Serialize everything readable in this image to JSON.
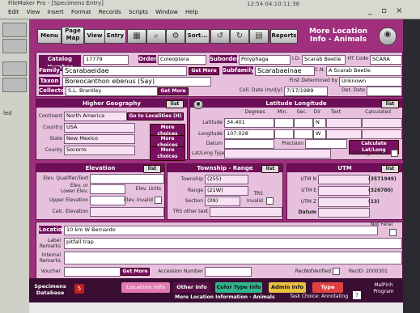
{
  "os": {
    "title": "FileMaker Pro - [Specimens Entry]",
    "menus": [
      "Edit",
      "View",
      "Insert",
      "Format",
      "Records",
      "Scripts",
      "Window",
      "Help"
    ],
    "clock": "12:54 04:10:11:38",
    "window_controls": "_ ▫ ×"
  },
  "left_panel": {
    "label": "led"
  },
  "toolbar": {
    "menu": "Menu",
    "page_map": "Page\nMap",
    "view": "View",
    "entry": "Entry",
    "sort": "Sort...",
    "reports": "Reports",
    "page_title": "More Location Info - Animals"
  },
  "catalog": {
    "catalog_number_label": "Catalog Number",
    "catalog_number": "17779",
    "order_label": "Order",
    "order": "Coleoptera",
    "suborder_label": "Suborder",
    "suborder": "Polyphaga",
    "id_label": "I.D.",
    "id": "Scarab Beetle",
    "ht_code_label": "HT Code",
    "ht_code": "SCARA",
    "family_label": "Family",
    "family": "Scarabaeidae",
    "get_more_1": "Get More",
    "subfamily_label": "Subfamily",
    "subfamily": "Scarabaeinae",
    "cn_label": "C.N.",
    "cn": "A Scarab Beetle",
    "taxon_label": "Taxon",
    "taxon": "Boreocanthon ebenus (Say)",
    "first_det_label": "First Determined by",
    "first_det": "Unknown",
    "collector_label": "Collector",
    "collector": "S.L. Brantley",
    "get_more_2": "Get More",
    "coll_date_label": "Coll. Date (m/d/y)",
    "coll_date": "7/17/1989",
    "det_date_label": "Det. Date",
    "det_date": ""
  },
  "higher_geo": {
    "title": "Higher Geography",
    "list": "list",
    "continent_label": "Continent",
    "continent": "North America",
    "go_to_localities": "Go to Localities (H)",
    "country_label": "Country",
    "country": "USA",
    "state_label": "State",
    "state": "New Mexico",
    "county_label": "County",
    "county": "Socorro",
    "more_choices": "More choices"
  },
  "latlong": {
    "title": "Latitude Longitude",
    "list": "list",
    "col_degrees": "Degrees",
    "col_min": "Min.",
    "col_sec": "Sec.",
    "col_dir": "Dir",
    "col_text": "Text",
    "col_calc": "Calculated",
    "latitude_label": "Latitude",
    "latitude": "34.401",
    "lat_dir": "N",
    "longitude_label": "Longitude",
    "longitude": "107.028",
    "long_dir": "W",
    "datum_label": "Datum",
    "precision_label": "Precision",
    "calc_button": "Calculate Lat/Long",
    "latlong_type_label": "Lat/Long Type",
    "latlong_invalid_label": "Lat/Long Invalid"
  },
  "elevation": {
    "title": "Elevation",
    "list": "list",
    "qualifier_label": "Elev. Qualifier/Text",
    "elev_or_label": "Elev. or",
    "lower_label": "Lower Elev.",
    "units_label": "Elev. Units",
    "upper_label": "Upper Elevation",
    "invalid_label": "Elev. Invalid",
    "calc_label": "Calc. Elevation"
  },
  "township": {
    "title": "Township - Range",
    "list": "list",
    "township_label": "Township",
    "township": "(255)",
    "range_label": "Range",
    "range": "(21W)",
    "section_label": "Section",
    "section": "(09)",
    "trs_label": "TRS",
    "trs_invalid_label": "Invalid",
    "trs_other_label": "TRS other text"
  },
  "utm": {
    "title": "UTM",
    "list": "list",
    "utm_n_label": "UTM N",
    "utm_n": "(3571949)",
    "utm_e_label": "UTM E",
    "utm_e": "(326780)",
    "utm_z_label": "UTM Z",
    "utm_z": "(13)",
    "datum_label": "Datum"
  },
  "remarks": {
    "location_label": "Location",
    "location": "10 km W Bernardo",
    "not_feral_label": "Not Feral",
    "label_remarks_label": "Label Remarks",
    "label_remarks": "pitfall trap",
    "internal_remarks_label": "Internal Remarks",
    "voucher_label": "Voucher",
    "get_more": "Get More",
    "accession_label": "Accession Number",
    "rec_not_verified_label": "RecNotVerified",
    "rec_id": "RecID: 2000301"
  },
  "footer": {
    "specimens_database": "Specimens Database",
    "record_num": "5",
    "tab_location": "Location Info",
    "tab_other": "Other Info",
    "tab_color": "Color Type Info",
    "tab_admin": "Admin Info",
    "tab_type": "Type",
    "status": "Task Choice: Annotating",
    "page_name": "More Location Information - Animals",
    "mammal_program": "MalPinh Program"
  },
  "colors": {
    "app_bg": "#a0307e",
    "panel": "#e6c0dc",
    "header": "#6e0e58"
  }
}
